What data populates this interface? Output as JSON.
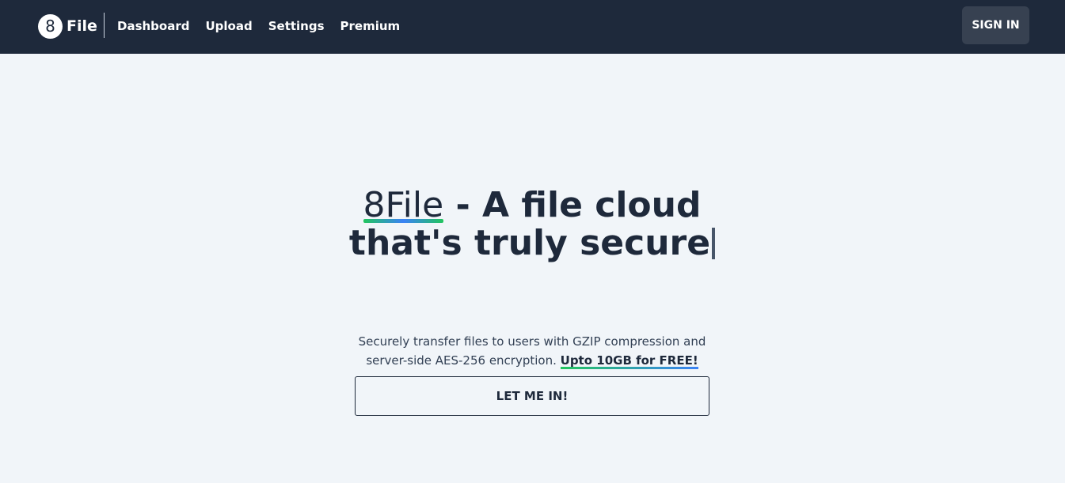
{
  "nav": {
    "brand_icon": "8",
    "brand_label": "File",
    "links": [
      {
        "label": "Dashboard"
      },
      {
        "label": "Upload"
      },
      {
        "label": "Settings"
      },
      {
        "label": "Premium"
      }
    ],
    "signin_label": "SIGN IN"
  },
  "hero": {
    "title_brand": "8File",
    "title_rest": " - A file cloud that's truly secure",
    "subtitle_text": "Securely transfer files to users with GZIP compression and server-side AES-256 encryption. ",
    "subtitle_highlight": "Upto 10GB for FREE!",
    "cta_label": "LET ME IN!"
  },
  "colors": {
    "navbar": "#1e293b",
    "page_background": "#f1f5f9",
    "signin_background": "#374151",
    "underline_gradient_start": "#22c55e",
    "underline_gradient_end": "#3b82f6"
  }
}
